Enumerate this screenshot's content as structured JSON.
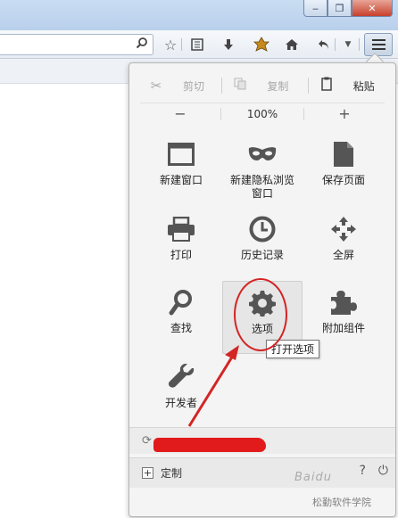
{
  "toolbar": {
    "search_glyph": "⚲",
    "icons": [
      "star-icon",
      "reading-list-icon",
      "download-icon",
      "addon-icon",
      "home-icon",
      "undo-icon",
      "dropdown-icon"
    ]
  },
  "edit": {
    "cut": "剪切",
    "copy": "复制",
    "paste": "粘贴"
  },
  "zoom": {
    "minus": "−",
    "value": "100%",
    "plus": "+"
  },
  "tiles": {
    "new_window": "新建窗口",
    "private_line1": "新建隐私浏览",
    "private_line2": "窗口",
    "save_page": "保存页面",
    "print": "打印",
    "history": "历史记录",
    "fullscreen": "全屏",
    "find": "查找",
    "options": "选项",
    "addons": "附加组件",
    "developer": "开发者"
  },
  "tooltip": "打开选项",
  "footer": {
    "customize": "定制"
  },
  "watermark": {
    "brand": "Baidu",
    "source": "松勤软件学院"
  },
  "colors": {
    "annotation_red": "#d42424",
    "panel_bg": "#f4f4f4"
  }
}
